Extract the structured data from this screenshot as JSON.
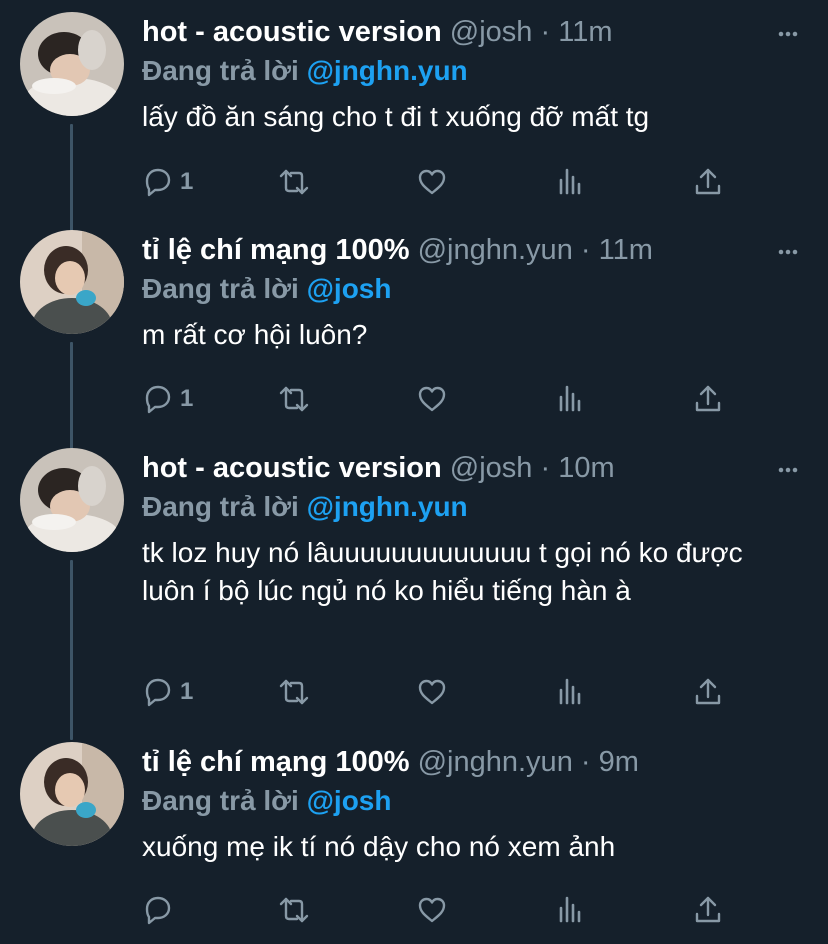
{
  "tweets": [
    {
      "name": "hot - acoustic version",
      "handle": "@josh",
      "time": "11m",
      "replying_label": "Đang trả lời",
      "mention": "@jnghn.yun",
      "text": "lấy đồ ăn sáng cho t đi t xuống đỡ mất tg",
      "reply_count": "1"
    },
    {
      "name": "tỉ lệ chí mạng 100%",
      "handle": "@jnghn.yun",
      "time": "11m",
      "replying_label": "Đang trả lời",
      "mention": "@josh",
      "text": "m rất cơ hội luôn?",
      "reply_count": "1"
    },
    {
      "name": "hot - acoustic version",
      "handle": "@josh",
      "time": "10m",
      "replying_label": "Đang trả lời",
      "mention": "@jnghn.yun",
      "text": "tk loz huy nó lâuuuuuuuuuuuuu t gọi nó ko được luôn í bộ lúc ngủ nó ko hiểu tiếng hàn à",
      "reply_count": "1"
    },
    {
      "name": "tỉ lệ chí mạng 100%",
      "handle": "@jnghn.yun",
      "time": "9m",
      "replying_label": "Đang trả lời",
      "mention": "@josh",
      "text": "xuống mẹ ik tí nó dậy cho nó xem ảnh",
      "reply_count": ""
    }
  ],
  "separator": " · ",
  "icons": [
    "reply-icon",
    "retweet-icon",
    "like-icon",
    "analytics-icon",
    "share-icon",
    "more-icon"
  ],
  "colors": {
    "background": "#15202b",
    "secondary": "#8899a6",
    "accent": "#1da1f2",
    "thread": "#3d5466"
  }
}
